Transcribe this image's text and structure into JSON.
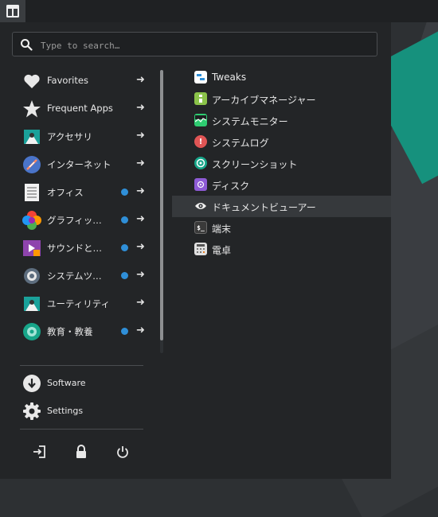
{
  "search": {
    "placeholder": "Type to search…"
  },
  "categories": [
    {
      "label": "Favorites",
      "icon": "heart-icon",
      "has_update": false
    },
    {
      "label": "Frequent Apps",
      "icon": "star-icon",
      "has_update": false
    },
    {
      "label": "アクセサリ",
      "icon": "accessories-icon",
      "has_update": false
    },
    {
      "label": "インターネット",
      "icon": "internet-icon",
      "has_update": false
    },
    {
      "label": "オフィス",
      "icon": "office-icon",
      "has_update": true
    },
    {
      "label": "グラフィッ…",
      "icon": "graphics-icon",
      "has_update": true
    },
    {
      "label": "サウンドと…",
      "icon": "sound-video-icon",
      "has_update": true
    },
    {
      "label": "システムツ…",
      "icon": "system-tools-icon",
      "has_update": true
    },
    {
      "label": "ユーティリティ",
      "icon": "utilities-icon",
      "has_update": false
    },
    {
      "label": "教育・教養",
      "icon": "education-icon",
      "has_update": true
    }
  ],
  "system_items": [
    {
      "label": "Software",
      "icon": "software-download-icon"
    },
    {
      "label": "Settings",
      "icon": "settings-gear-icon"
    }
  ],
  "apps": [
    {
      "label": "Tweaks",
      "icon": "tweaks-icon",
      "color": "#ffffff",
      "selected": false
    },
    {
      "label": "アーカイブマネージャー",
      "icon": "archive-manager-icon",
      "color": "#8bc34a",
      "selected": false
    },
    {
      "label": "システムモニター",
      "icon": "system-monitor-icon",
      "color": "#2ecc71",
      "selected": false
    },
    {
      "label": "システムログ",
      "icon": "system-log-icon",
      "color": "#e05555",
      "selected": false
    },
    {
      "label": "スクリーンショット",
      "icon": "screenshot-icon",
      "color": "#17a589",
      "selected": false
    },
    {
      "label": "ディスク",
      "icon": "disks-icon",
      "color": "#8e5bd6",
      "selected": false
    },
    {
      "label": "ドキュメントビューアー",
      "icon": "document-viewer-icon",
      "color": "#3b3e41",
      "selected": true
    },
    {
      "label": "端末",
      "icon": "terminal-icon",
      "color": "#2b2b2b",
      "selected": false
    },
    {
      "label": "電卓",
      "icon": "calculator-icon",
      "color": "#e0e0e0",
      "selected": false
    }
  ],
  "power": [
    "logout-icon",
    "lock-icon",
    "power-icon"
  ],
  "colors": {
    "accent": "#2f8fd8",
    "menu_bg": "#232527",
    "selection": "#36393c"
  }
}
